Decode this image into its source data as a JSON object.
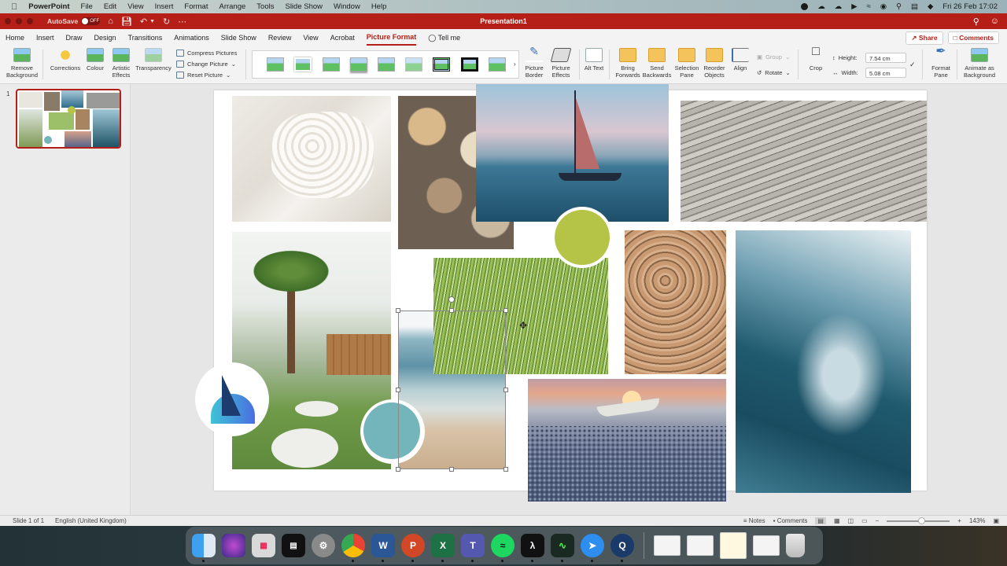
{
  "menubar": {
    "app_name": "PowerPoint",
    "items": [
      "File",
      "Edit",
      "View",
      "Insert",
      "Format",
      "Arrange",
      "Tools",
      "Slide Show",
      "Window",
      "Help"
    ],
    "clock": "Fri 26 Feb  17:02"
  },
  "titlebar": {
    "autosave_label": "AutoSave",
    "autosave_state": "OFF",
    "doc_title": "Presentation1"
  },
  "tabs": {
    "items": [
      "Home",
      "Insert",
      "Draw",
      "Design",
      "Transitions",
      "Animations",
      "Slide Show",
      "Review",
      "View",
      "Acrobat",
      "Picture Format"
    ],
    "active": "Picture Format",
    "tell_me": "Tell me",
    "share": "Share",
    "comments": "Comments"
  },
  "ribbon": {
    "remove_background": "Remove Background",
    "corrections": "Corrections",
    "colour": "Colour",
    "artistic_effects": "Artistic Effects",
    "transparency": "Transparency",
    "compress_pictures": "Compress Pictures",
    "change_picture": "Change Picture",
    "reset_picture": "Reset Picture",
    "picture_border": "Picture Border",
    "picture_effects": "Picture Effects",
    "alt_text": "Alt Text",
    "bring_forwards": "Bring Forwards",
    "send_backwards": "Send Backwards",
    "selection_pane": "Selection Pane",
    "reorder_objects": "Reorder Objects",
    "align": "Align",
    "group": "Group",
    "rotate": "Rotate",
    "crop": "Crop",
    "height_label": "Height:",
    "height_value": "7.54 cm",
    "width_label": "Width:",
    "width_value": "5.08 cm",
    "format_pane": "Format Pane",
    "animate_as_background": "Animate as Background"
  },
  "thumbnails": {
    "slide_number": "1"
  },
  "slide": {
    "accent_green": "#b5c347",
    "accent_teal": "#74b4bb",
    "photos": [
      "knit-blanket",
      "seashells",
      "sailboat-sunset",
      "driftwood",
      "palm-house",
      "beach-grass",
      "beach-shore",
      "rope-coils",
      "boat-on-pebbles",
      "ocean-wave"
    ]
  },
  "statusbar": {
    "slide_info": "Slide 1 of 1",
    "language": "English (United Kingdom)",
    "notes": "Notes",
    "comments": "Comments",
    "zoom_percent": "143%",
    "zoom_fraction": 0.55
  },
  "dock": {
    "apps": [
      "Finder",
      "Siri",
      "Launchpad",
      "Mission Control",
      "System Preferences",
      "Chrome",
      "Word",
      "PowerPoint",
      "Excel",
      "Teams",
      "Spotify",
      "Acrobat",
      "Activity Monitor",
      "Safari",
      "QuickTime"
    ]
  }
}
